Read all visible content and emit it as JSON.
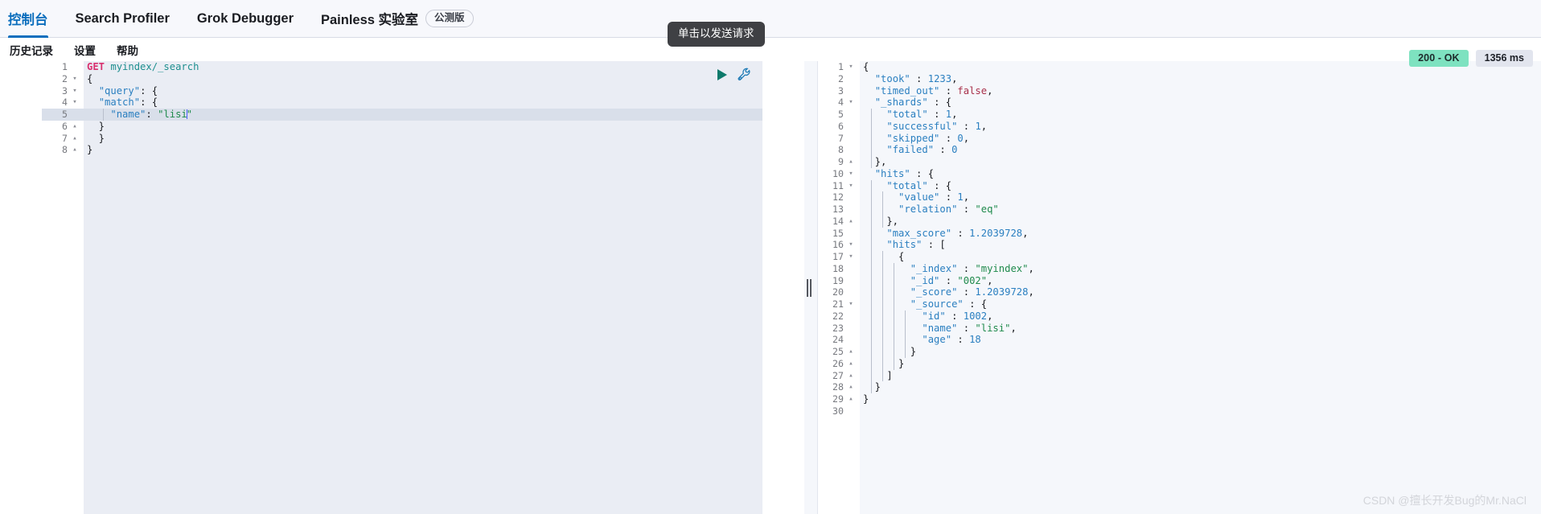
{
  "topbar": {
    "tabs": [
      {
        "label": "控制台",
        "active": true
      },
      {
        "label": "Search Profiler",
        "active": false
      },
      {
        "label": "Grok Debugger",
        "active": false
      },
      {
        "label": "Painless 实验室",
        "active": false,
        "badge": "公测版"
      }
    ]
  },
  "submenu": {
    "items": [
      "历史记录",
      "设置",
      "帮助"
    ]
  },
  "status": {
    "code": "200 - OK",
    "time": "1356 ms",
    "ok_color": "#7ee2c0",
    "time_color": "#e2e5ee"
  },
  "tooltip": {
    "text": "单击以发送请求"
  },
  "icons": {
    "play": "play-icon",
    "wrench": "wrench-icon",
    "splitter": "drag-handle-icon"
  },
  "request_editor": {
    "active_line": 5,
    "lines": [
      {
        "n": "1",
        "fold": "",
        "code": "GET myindex/_search"
      },
      {
        "n": "2",
        "fold": "▾",
        "code": "{"
      },
      {
        "n": "3",
        "fold": "▾",
        "code": "  \"query\": {"
      },
      {
        "n": "4",
        "fold": "▾",
        "code": "  \"match\": {"
      },
      {
        "n": "5",
        "fold": "",
        "code": "    \"name\": \"lisi\""
      },
      {
        "n": "6",
        "fold": "▴",
        "code": "  }"
      },
      {
        "n": "7",
        "fold": "▴",
        "code": "  }"
      },
      {
        "n": "8",
        "fold": "▴",
        "code": "}"
      }
    ]
  },
  "response_editor": {
    "lines": [
      {
        "n": "1",
        "fold": "▾",
        "code": "{"
      },
      {
        "n": "2",
        "fold": "",
        "code": "  \"took\" : 1233,"
      },
      {
        "n": "3",
        "fold": "",
        "code": "  \"timed_out\" : false,"
      },
      {
        "n": "4",
        "fold": "▾",
        "code": "  \"_shards\" : {"
      },
      {
        "n": "5",
        "fold": "",
        "code": "    \"total\" : 1,"
      },
      {
        "n": "6",
        "fold": "",
        "code": "    \"successful\" : 1,"
      },
      {
        "n": "7",
        "fold": "",
        "code": "    \"skipped\" : 0,"
      },
      {
        "n": "8",
        "fold": "",
        "code": "    \"failed\" : 0"
      },
      {
        "n": "9",
        "fold": "▴",
        "code": "  },"
      },
      {
        "n": "10",
        "fold": "▾",
        "code": "  \"hits\" : {"
      },
      {
        "n": "11",
        "fold": "▾",
        "code": "    \"total\" : {"
      },
      {
        "n": "12",
        "fold": "",
        "code": "      \"value\" : 1,"
      },
      {
        "n": "13",
        "fold": "",
        "code": "      \"relation\" : \"eq\""
      },
      {
        "n": "14",
        "fold": "▴",
        "code": "    },"
      },
      {
        "n": "15",
        "fold": "",
        "code": "    \"max_score\" : 1.2039728,"
      },
      {
        "n": "16",
        "fold": "▾",
        "code": "    \"hits\" : ["
      },
      {
        "n": "17",
        "fold": "▾",
        "code": "      {"
      },
      {
        "n": "18",
        "fold": "",
        "code": "        \"_index\" : \"myindex\","
      },
      {
        "n": "19",
        "fold": "",
        "code": "        \"_id\" : \"002\","
      },
      {
        "n": "20",
        "fold": "",
        "code": "        \"_score\" : 1.2039728,"
      },
      {
        "n": "21",
        "fold": "▾",
        "code": "        \"_source\" : {"
      },
      {
        "n": "22",
        "fold": "",
        "code": "          \"id\" : 1002,"
      },
      {
        "n": "23",
        "fold": "",
        "code": "          \"name\" : \"lisi\","
      },
      {
        "n": "24",
        "fold": "",
        "code": "          \"age\" : 18"
      },
      {
        "n": "25",
        "fold": "▴",
        "code": "        }"
      },
      {
        "n": "26",
        "fold": "▴",
        "code": "      }"
      },
      {
        "n": "27",
        "fold": "▴",
        "code": "    ]"
      },
      {
        "n": "28",
        "fold": "▴",
        "code": "  }"
      },
      {
        "n": "29",
        "fold": "▴",
        "code": "}"
      },
      {
        "n": "30",
        "fold": "",
        "code": ""
      }
    ]
  },
  "watermark": {
    "text": "CSDN @擅长开发Bug的Mr.NaCl"
  }
}
